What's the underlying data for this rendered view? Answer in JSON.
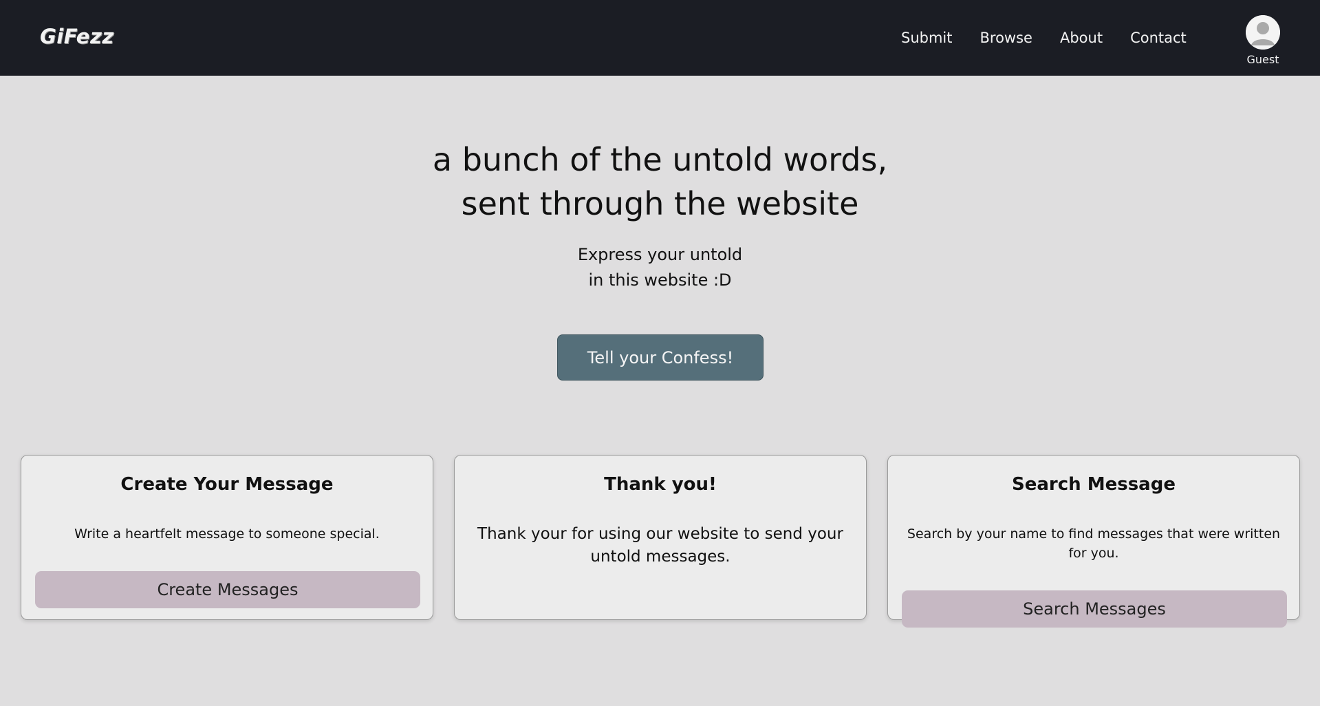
{
  "navbar": {
    "brand": "GiFezz",
    "links": [
      "Submit",
      "Browse",
      "About",
      "Contact"
    ],
    "user_label": "Guest",
    "avatar_icon": "user-avatar-icon",
    "background": "#1b1d24"
  },
  "hero": {
    "title_line1": "a bunch of the untold words,",
    "title_line2": "sent through the website",
    "sub_line1": "Express your untold",
    "sub_line2": "in this website :D",
    "cta_label": "Tell your Confess!",
    "cta_color": "#556f7a"
  },
  "cards": [
    {
      "title": "Create Your Message",
      "text": "Write a heartfelt message to someone special.",
      "button": "Create Messages"
    },
    {
      "title": "Thank you!",
      "text": "Thank your for using our website to send your untold messages."
    },
    {
      "title": "Search Message",
      "text": "Search by your name to find messages that were written for you.",
      "button": "Search Messages"
    }
  ],
  "colors": {
    "page_background": "#dfdedf",
    "card_background": "#ececec",
    "card_button": "#c6b8c3"
  }
}
